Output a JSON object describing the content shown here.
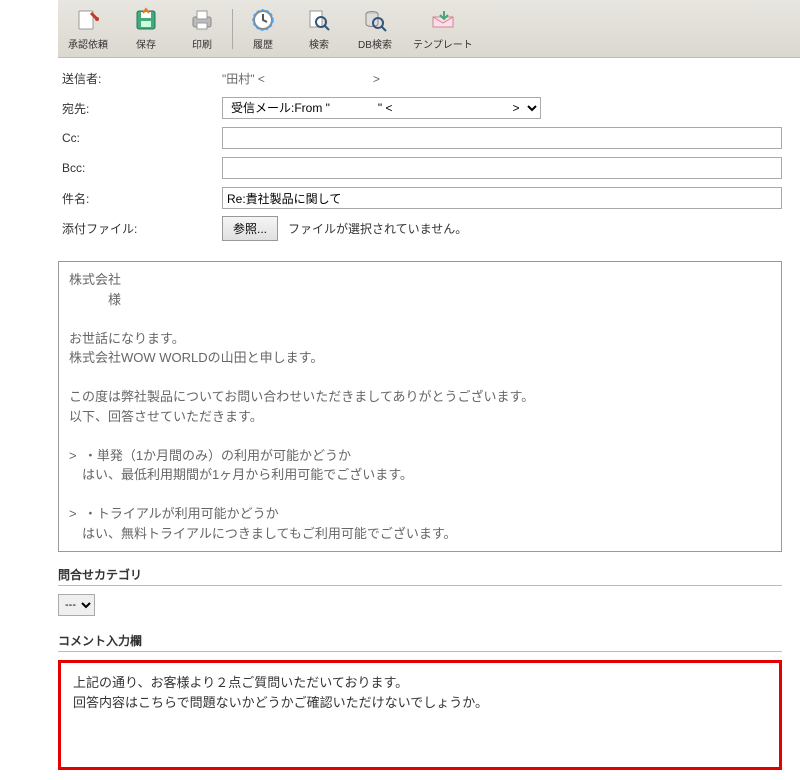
{
  "toolbar": {
    "approve": "承認依頼",
    "save": "保存",
    "print": "印刷",
    "history": "履歴",
    "search": "検索",
    "dbsearch": "DB検索",
    "template": "テンプレート"
  },
  "fields": {
    "sender_label": "送信者:",
    "sender_value": "\"田村\" <　　　　　　　　　>",
    "to_label": "宛先:",
    "to_value": "受信メール:From \"　　　　\" <　　　　　　　　　　> ",
    "cc_label": "Cc:",
    "cc_value": "",
    "bcc_label": "Bcc:",
    "bcc_value": "",
    "subject_label": "件名:",
    "subject_value": "Re:貴社製品に関して",
    "attach_label": "添付ファイル:",
    "browse_btn": "参照...",
    "file_status": "ファイルが選択されていません。"
  },
  "body": "株式会社\n　　　様\n\nお世話になります。\n株式会社WOW WORLDの山田と申します。\n\nこの度は弊社製品についてお問い合わせいただきましてありがとうございます。\n以下、回答させていただきます。\n\n>  ・単発（1か月間のみ）の利用が可能かどうか\n　はい、最低利用期間が1ヶ月から利用可能でございます。\n\n>  ・トライアルが利用可能かどうか\n　はい、無料トライアルにつきましてもご利用可能でございます。",
  "category": {
    "header": "問合せカテゴリ",
    "selected": "---"
  },
  "comment": {
    "header": "コメント入力欄",
    "text": "上記の通り、お客様より２点ご質問いただいております。\n回答内容はこちらで問題ないかどうかご確認いただけないでしょうか。"
  }
}
